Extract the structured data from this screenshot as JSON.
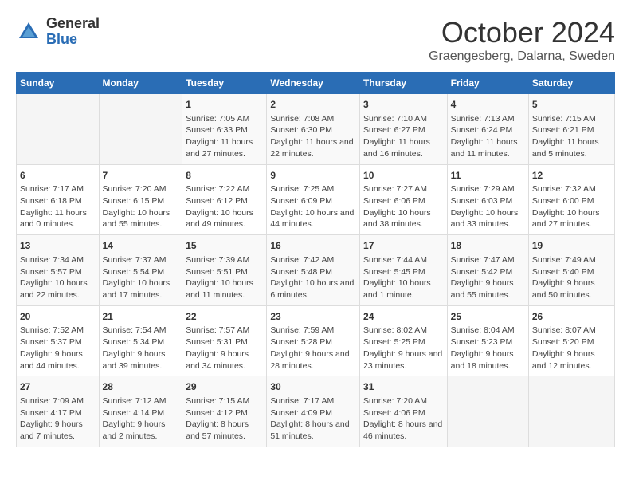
{
  "logo": {
    "general": "General",
    "blue": "Blue"
  },
  "title": "October 2024",
  "subtitle": "Graengesberg, Dalarna, Sweden",
  "days_of_week": [
    "Sunday",
    "Monday",
    "Tuesday",
    "Wednesday",
    "Thursday",
    "Friday",
    "Saturday"
  ],
  "weeks": [
    [
      {
        "day": "",
        "info": ""
      },
      {
        "day": "",
        "info": ""
      },
      {
        "day": "1",
        "info": "Sunrise: 7:05 AM\nSunset: 6:33 PM\nDaylight: 11 hours and 27 minutes."
      },
      {
        "day": "2",
        "info": "Sunrise: 7:08 AM\nSunset: 6:30 PM\nDaylight: 11 hours and 22 minutes."
      },
      {
        "day": "3",
        "info": "Sunrise: 7:10 AM\nSunset: 6:27 PM\nDaylight: 11 hours and 16 minutes."
      },
      {
        "day": "4",
        "info": "Sunrise: 7:13 AM\nSunset: 6:24 PM\nDaylight: 11 hours and 11 minutes."
      },
      {
        "day": "5",
        "info": "Sunrise: 7:15 AM\nSunset: 6:21 PM\nDaylight: 11 hours and 5 minutes."
      }
    ],
    [
      {
        "day": "6",
        "info": "Sunrise: 7:17 AM\nSunset: 6:18 PM\nDaylight: 11 hours and 0 minutes."
      },
      {
        "day": "7",
        "info": "Sunrise: 7:20 AM\nSunset: 6:15 PM\nDaylight: 10 hours and 55 minutes."
      },
      {
        "day": "8",
        "info": "Sunrise: 7:22 AM\nSunset: 6:12 PM\nDaylight: 10 hours and 49 minutes."
      },
      {
        "day": "9",
        "info": "Sunrise: 7:25 AM\nSunset: 6:09 PM\nDaylight: 10 hours and 44 minutes."
      },
      {
        "day": "10",
        "info": "Sunrise: 7:27 AM\nSunset: 6:06 PM\nDaylight: 10 hours and 38 minutes."
      },
      {
        "day": "11",
        "info": "Sunrise: 7:29 AM\nSunset: 6:03 PM\nDaylight: 10 hours and 33 minutes."
      },
      {
        "day": "12",
        "info": "Sunrise: 7:32 AM\nSunset: 6:00 PM\nDaylight: 10 hours and 27 minutes."
      }
    ],
    [
      {
        "day": "13",
        "info": "Sunrise: 7:34 AM\nSunset: 5:57 PM\nDaylight: 10 hours and 22 minutes."
      },
      {
        "day": "14",
        "info": "Sunrise: 7:37 AM\nSunset: 5:54 PM\nDaylight: 10 hours and 17 minutes."
      },
      {
        "day": "15",
        "info": "Sunrise: 7:39 AM\nSunset: 5:51 PM\nDaylight: 10 hours and 11 minutes."
      },
      {
        "day": "16",
        "info": "Sunrise: 7:42 AM\nSunset: 5:48 PM\nDaylight: 10 hours and 6 minutes."
      },
      {
        "day": "17",
        "info": "Sunrise: 7:44 AM\nSunset: 5:45 PM\nDaylight: 10 hours and 1 minute."
      },
      {
        "day": "18",
        "info": "Sunrise: 7:47 AM\nSunset: 5:42 PM\nDaylight: 9 hours and 55 minutes."
      },
      {
        "day": "19",
        "info": "Sunrise: 7:49 AM\nSunset: 5:40 PM\nDaylight: 9 hours and 50 minutes."
      }
    ],
    [
      {
        "day": "20",
        "info": "Sunrise: 7:52 AM\nSunset: 5:37 PM\nDaylight: 9 hours and 44 minutes."
      },
      {
        "day": "21",
        "info": "Sunrise: 7:54 AM\nSunset: 5:34 PM\nDaylight: 9 hours and 39 minutes."
      },
      {
        "day": "22",
        "info": "Sunrise: 7:57 AM\nSunset: 5:31 PM\nDaylight: 9 hours and 34 minutes."
      },
      {
        "day": "23",
        "info": "Sunrise: 7:59 AM\nSunset: 5:28 PM\nDaylight: 9 hours and 28 minutes."
      },
      {
        "day": "24",
        "info": "Sunrise: 8:02 AM\nSunset: 5:25 PM\nDaylight: 9 hours and 23 minutes."
      },
      {
        "day": "25",
        "info": "Sunrise: 8:04 AM\nSunset: 5:23 PM\nDaylight: 9 hours and 18 minutes."
      },
      {
        "day": "26",
        "info": "Sunrise: 8:07 AM\nSunset: 5:20 PM\nDaylight: 9 hours and 12 minutes."
      }
    ],
    [
      {
        "day": "27",
        "info": "Sunrise: 7:09 AM\nSunset: 4:17 PM\nDaylight: 9 hours and 7 minutes."
      },
      {
        "day": "28",
        "info": "Sunrise: 7:12 AM\nSunset: 4:14 PM\nDaylight: 9 hours and 2 minutes."
      },
      {
        "day": "29",
        "info": "Sunrise: 7:15 AM\nSunset: 4:12 PM\nDaylight: 8 hours and 57 minutes."
      },
      {
        "day": "30",
        "info": "Sunrise: 7:17 AM\nSunset: 4:09 PM\nDaylight: 8 hours and 51 minutes."
      },
      {
        "day": "31",
        "info": "Sunrise: 7:20 AM\nSunset: 4:06 PM\nDaylight: 8 hours and 46 minutes."
      },
      {
        "day": "",
        "info": ""
      },
      {
        "day": "",
        "info": ""
      }
    ]
  ]
}
